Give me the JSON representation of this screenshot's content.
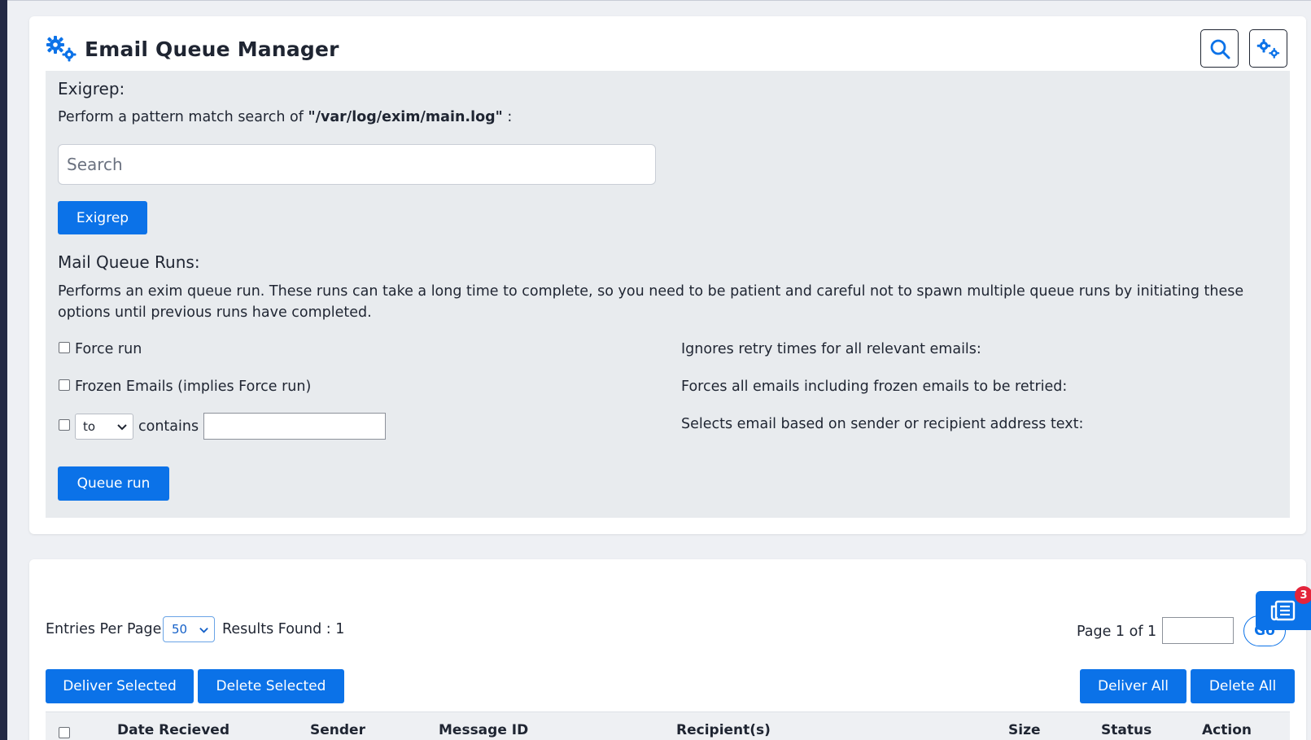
{
  "header": {
    "title": "Email Queue Manager",
    "title_icon": "gears-icon",
    "search_icon": "search-icon",
    "settings_icon": "gears-icon"
  },
  "exigrep": {
    "heading": "Exigrep:",
    "description_prefix": "Perform a pattern match search of ",
    "log_path": "\"/var/log/exim/main.log\"",
    "description_suffix": " :",
    "search_placeholder": "Search",
    "search_value": "",
    "button_label": "Exigrep"
  },
  "queue_runs": {
    "heading": "Mail Queue Runs:",
    "description": "Performs an exim queue run. These runs can take a long time to complete, so you need to be patient and careful not to spawn multiple queue runs by initiating these options until previous runs have completed.",
    "options": [
      {
        "label": "Force run",
        "checked": false,
        "help": "Ignores retry times for all relevant emails:"
      },
      {
        "label": "Frozen Emails (implies Force run)",
        "checked": false,
        "help": "Forces all emails including frozen emails to be retried:"
      },
      {
        "label": "",
        "checked": false,
        "help": "Selects email based on sender or recipient address text:"
      }
    ],
    "match_field": "to",
    "contains_label": "contains",
    "contains_value": "",
    "button_label": "Queue run"
  },
  "queue_list": {
    "entries_label": "Entries Per Page",
    "entries_value": "50",
    "results_label": "Results Found : 1",
    "page_label": "Page 1 of 1",
    "page_input_value": "",
    "go_label": "Go",
    "buttons": {
      "deliver_selected": "Deliver Selected",
      "delete_selected": "Delete Selected",
      "deliver_all": "Deliver All",
      "delete_all": "Delete All"
    },
    "columns": [
      "Date Recieved",
      "Sender",
      "Message ID",
      "Recipient(s)",
      "Size",
      "Status",
      "Action"
    ]
  },
  "widget": {
    "badge_count": "3",
    "icon": "news-icon"
  },
  "colors": {
    "accent": "#0b72e8",
    "panel_bg": "#e8ebee",
    "badge": "#e3243b",
    "text": "#1f2532"
  }
}
